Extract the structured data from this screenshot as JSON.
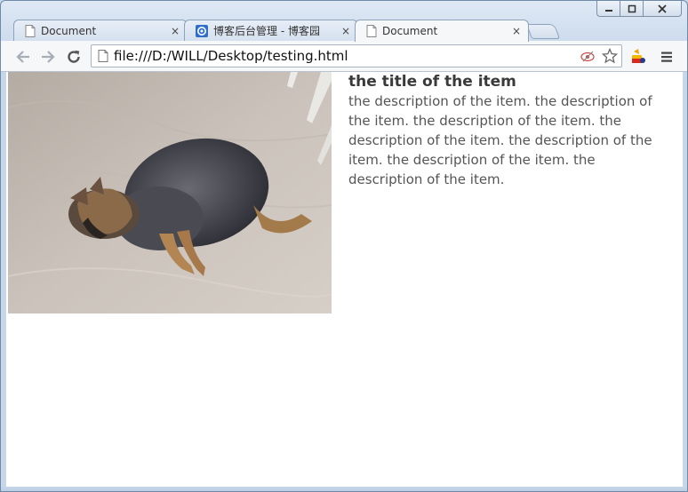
{
  "window": {
    "caption_buttons": [
      "minimize",
      "maximize",
      "close"
    ]
  },
  "tabs": [
    {
      "title": "Document",
      "icon": "page-icon",
      "active": false,
      "close": "×"
    },
    {
      "title": "博客后台管理 - 博客园",
      "icon": "cnblogs-icon",
      "active": false,
      "close": "×"
    },
    {
      "title": "Document",
      "icon": "page-icon",
      "active": true,
      "close": "×"
    }
  ],
  "toolbar": {
    "url": "file:///D:/WILL/Desktop/testing.html"
  },
  "content": {
    "image_alt": "fat dog lying on sand",
    "title": "the title of the item",
    "description": "the description of the item. the description of the item. the description of the item. the description of the item. the description of the item. the description of the item. the description of the item."
  }
}
